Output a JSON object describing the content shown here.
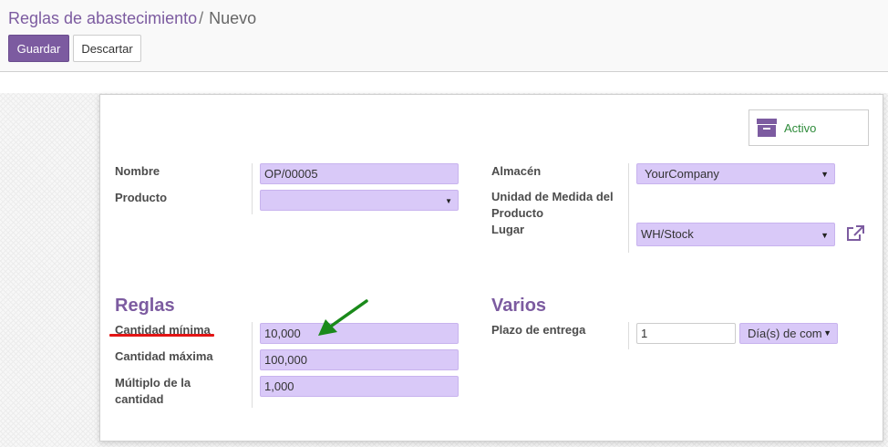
{
  "breadcrumb": {
    "parent": "Reglas de abastecimiento",
    "separator": "/",
    "current": "Nuevo"
  },
  "toolbar": {
    "save_label": "Guardar",
    "discard_label": "Descartar"
  },
  "status_button": {
    "icon": "archive-icon",
    "label": "Activo"
  },
  "left_group": {
    "name_label": "Nombre",
    "name_value": "OP/00005",
    "product_label": "Producto",
    "product_value": ""
  },
  "right_group": {
    "warehouse_label": "Almacén",
    "warehouse_value": "YourCompany",
    "uom_label_line1": "Unidad de Medida del",
    "uom_label_line2": "Producto",
    "location_label": "Lugar",
    "location_value": "WH/Stock"
  },
  "rules": {
    "title": "Reglas",
    "min_label": "Cantidad mínima",
    "min_value": "10,000",
    "max_label": "Cantidad máxima",
    "max_value": "100,000",
    "multiple_label_line1": "Múltiplo de la",
    "multiple_label_line2": "cantidad",
    "multiple_value": "1,000"
  },
  "misc": {
    "title": "Varios",
    "lead_label": "Plazo de entrega",
    "lead_value": "1",
    "lead_unit": "Día(s) de com"
  },
  "colors": {
    "brand": "#7c5ba0",
    "required_field": "#d9c9f8",
    "active_green": "#2e8b3a",
    "annotation_red": "#e31515",
    "annotation_green": "#1a8a1a"
  }
}
